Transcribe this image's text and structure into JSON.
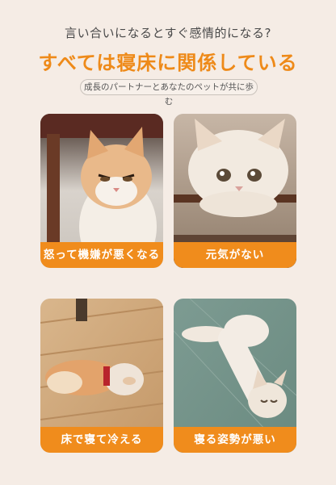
{
  "header": {
    "subtitle": "言い合いになるとすぐ感情的になる?",
    "headline": "すべては寝床に関係している",
    "tagline": "成長のパートナーとあなたのペットが共に歩む"
  },
  "cards": [
    {
      "label": "怒って機嫌が悪くなる",
      "photo": "angry-cat-photo"
    },
    {
      "label": "元気がない",
      "photo": "tired-cat-photo"
    },
    {
      "label": "床で寝て冷える",
      "photo": "cat-on-floor-photo"
    },
    {
      "label": "寝る姿勢が悪い",
      "photo": "cat-bad-posture-photo"
    }
  ],
  "colors": {
    "background": "#f5ece5",
    "accent": "#f08c1c",
    "headline": "#ee8a19"
  }
}
